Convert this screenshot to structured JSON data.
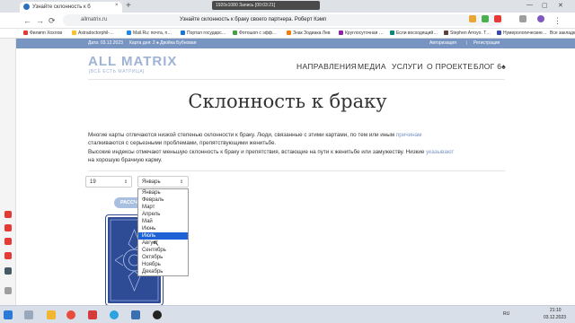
{
  "browser": {
    "tab_title": "Узнайте склонность к б",
    "tab_close": "×",
    "new_tab": "+",
    "recording": "1920x1080   Запись [00:03:21]",
    "url": "allmatrix.ru",
    "page_title": "Узнайте склонность к браку своего партнера. Роберт Кэмп",
    "back": "←",
    "forward": "→",
    "reload": "⟳",
    "bookmarks": [
      "Филипп Хохлов",
      "Astradoctorphil-…",
      "Mail.Ru: почта, п…",
      "Портал государс…",
      "Фотошоп с эфф…",
      "Знак Зодиака Лев",
      "Круглосуточная …",
      "Если восходящий…",
      "Stephen Arroyo. Т…",
      "Нумерологические…",
      "Все закладки"
    ]
  },
  "site": {
    "topbar": {
      "date": "Дата: 03.12.2023",
      "card_of_day": "Карта дня: 2 ♠ Двойка Бубновая",
      "login": "Авторизация",
      "register": "Регистрация"
    },
    "logo": "ALL MATRIX",
    "logo_sub": "[ВСЁ ЕСТЬ МАТРИЦА]",
    "nav": [
      "НАПРАВЛЕНИЯ",
      "МЕДИА",
      "УСЛУГИ",
      "О ПРОЕКТЕ",
      "БЛОГ 6♠"
    ]
  },
  "content": {
    "heading": "Склонность к браку",
    "para1_l1a": "Многие  карты  отличаются  низкой  степенью  склонности  к  браку.  Люди,  связанные  с  этими  картами,  по  тем  или  иным ",
    "para1_l1b": "причинам",
    "para1_l2": "сталкиваются с серьезными проблемами, препятствующими женитьбе.",
    "para2_l1a": "Высокие индексы отмечают меньшую склонность к браку и препятствия, встающие на пути к женитьбе или замужеству. Низкие ",
    "para2_l1b": "указывают",
    "para2_l2": "на хорошую брачную карму."
  },
  "form": {
    "day_value": "19",
    "month_value": "Январь",
    "calc_label": "РАССЧИ",
    "months": [
      "Январь",
      "Февраль",
      "Март",
      "Апрель",
      "Май",
      "Июнь",
      "Июль",
      "Август",
      "Сентябрь",
      "Октябрь",
      "Ноябрь",
      "Декабрь"
    ],
    "highlighted_month": "Июль"
  },
  "taskbar": {
    "lang": "RU",
    "time": "21:10",
    "date": "03.12.2023"
  },
  "colors": {
    "accent": "#7895c2",
    "card": "#2e4c95",
    "highlight": "#1e63d6"
  }
}
